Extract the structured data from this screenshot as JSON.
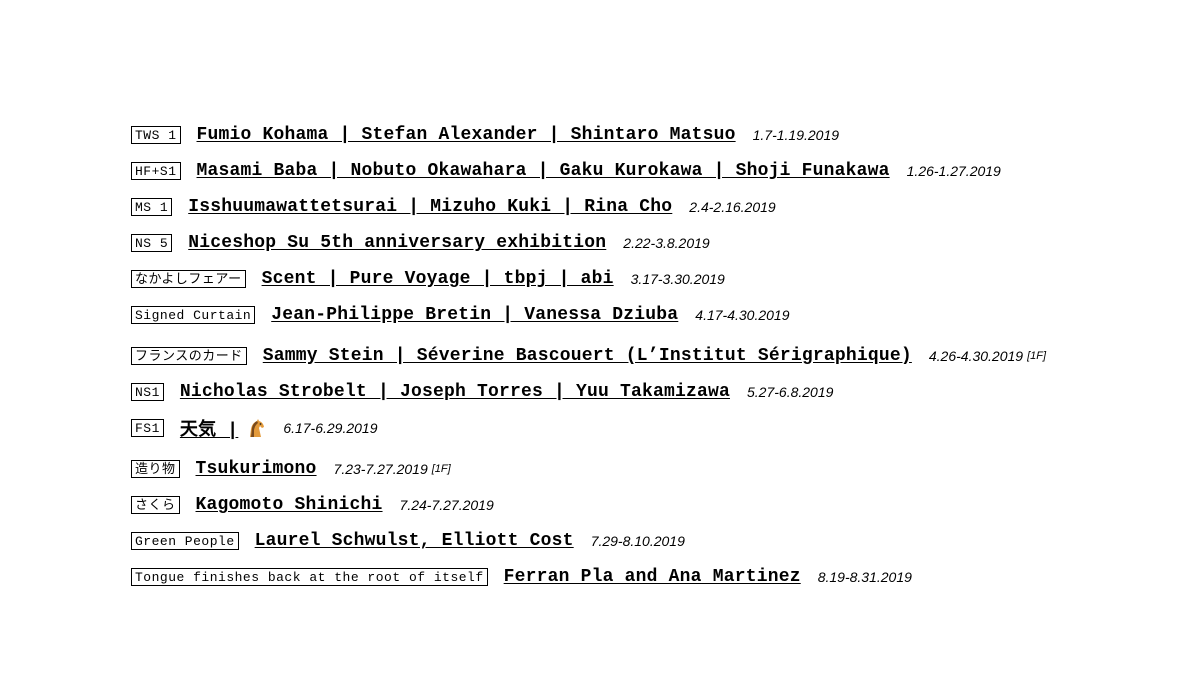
{
  "exhibitions": [
    {
      "tag": "TWS 1",
      "title": "Fumio Kohama | Stefan Alexander | Shintaro Matsuo",
      "date": "1.7-1.19.2019"
    },
    {
      "tag": "HF+S1",
      "title": "Masami Baba | Nobuto Okawahara | Gaku Kurokawa | Shoji Funakawa",
      "date": "1.26-1.27.2019"
    },
    {
      "tag": "MS 1",
      "title": "Isshuumawattetsurai | Mizuho Kuki | Rina Cho",
      "date": "2.4-2.16.2019"
    },
    {
      "tag": "NS 5",
      "title": "Niceshop Su 5th anniversary exhibition",
      "date": "2.22-3.8.2019"
    },
    {
      "tag": "なかよしフェアー",
      "title": "Scent | Pure Voyage | tbpj | abi",
      "date": "3.17-3.30.2019"
    },
    {
      "tag": "Signed Curtain",
      "title": "Jean-Philippe Bretin | Vanessa Dziuba",
      "date": "4.17-4.30.2019"
    },
    {
      "tag": "フランスのカード",
      "title": "Sammy Stein | Séverine Bascouert (L’Institut Sérigraphique)",
      "date": "4.26-4.30.2019",
      "note": "[1F]"
    },
    {
      "tag": "NS1",
      "title": "Nicholas Strobelt | Joseph Torres | Yuu Takamizawa",
      "date": "5.27-6.8.2019"
    },
    {
      "tag": "FS1",
      "title": "天気 |",
      "icon": "horse-emoji-icon",
      "date": "6.17-6.29.2019"
    },
    {
      "tag": "造り物",
      "title": "Tsukurimono",
      "date": "7.23-7.27.2019",
      "note": "[1F]"
    },
    {
      "tag": "さくら",
      "title": "Kagomoto Shinichi",
      "date": "7.24-7.27.2019"
    },
    {
      "tag": "Green People",
      "title": "Laurel Schwulst, Elliott Cost",
      "date": "7.29-8.10.2019"
    },
    {
      "tag": "Tongue finishes back at the root of itself",
      "title": "Ferran Pla and Ana Martinez",
      "date": "8.19-8.31.2019"
    }
  ]
}
